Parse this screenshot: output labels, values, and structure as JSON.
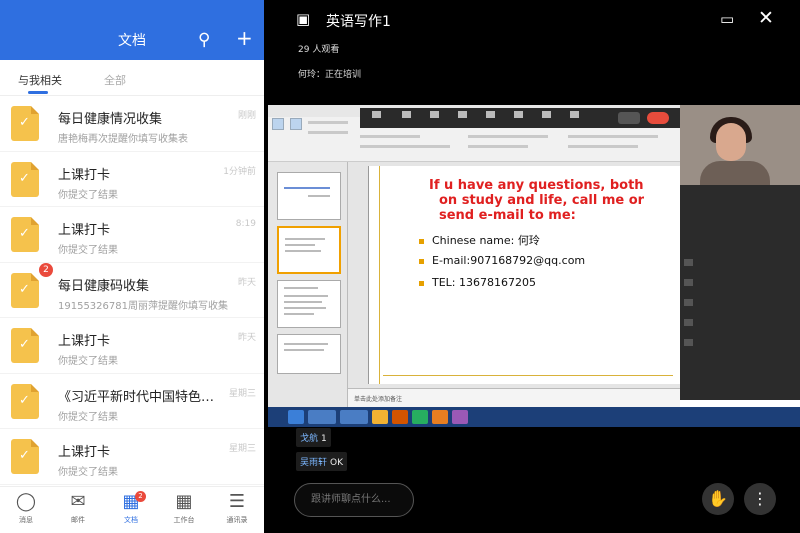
{
  "header": {
    "title": "文档"
  },
  "tabs": [
    {
      "label": "与我相关"
    },
    {
      "label": "全部"
    }
  ],
  "docs": [
    {
      "title": "每日健康情况收集",
      "sub": "唐艳梅再次提醒你填写收集表",
      "time": "刚刚",
      "badge": ""
    },
    {
      "title": "上课打卡",
      "sub": "你提交了结果",
      "time": "1分钟前",
      "badge": ""
    },
    {
      "title": "上课打卡",
      "sub": "你提交了结果",
      "time": "8:19",
      "badge": ""
    },
    {
      "title": "每日健康码收集",
      "sub": "19155326781周丽萍提醒你填写收集表",
      "time": "昨天",
      "badge": "2"
    },
    {
      "title": "上课打卡",
      "sub": "你提交了结果",
      "time": "昨天",
      "badge": ""
    },
    {
      "title": "《习近平新时代中国特色…",
      "sub": "你提交了结果",
      "time": "星期三",
      "badge": ""
    },
    {
      "title": "上课打卡",
      "sub": "你提交了结果",
      "time": "星期三",
      "badge": ""
    }
  ],
  "nav": [
    {
      "label": "消息",
      "icon": "chat-bubble-icon"
    },
    {
      "label": "邮件",
      "icon": "mail-icon"
    },
    {
      "label": "文档",
      "icon": "document-icon",
      "badge": "2"
    },
    {
      "label": "工作台",
      "icon": "workbench-grid-icon"
    },
    {
      "label": "通讯录",
      "icon": "contacts-icon"
    }
  ],
  "meeting": {
    "title": "英语写作1",
    "watching": "29 人观看",
    "speaking": "何玲：正在培训"
  },
  "slide": {
    "question": "If u have any questions, both on study and life, call me or send e-mail to me:",
    "q_line1": "If u have any questions, both",
    "q_line2": "on study and life, call me or",
    "q_line3": "send e-mail to me:",
    "b1": "Chinese name: 何玲",
    "b2": "E-mail:907168792@qq.com",
    "b3": "TEL: 13678167205",
    "notes": "单击此处添加备注"
  },
  "chat": [
    {
      "user": "戈航",
      "msg": "1"
    },
    {
      "user": "吴雨轩",
      "msg": "OK"
    }
  ],
  "input": {
    "placeholder": "跟讲师聊点什么..."
  },
  "colors": {
    "brand_blue": "#2f6fe0",
    "badge_red": "#ea4a3c",
    "doc_yellow": "#f5c24c",
    "slide_red": "#e02020"
  }
}
